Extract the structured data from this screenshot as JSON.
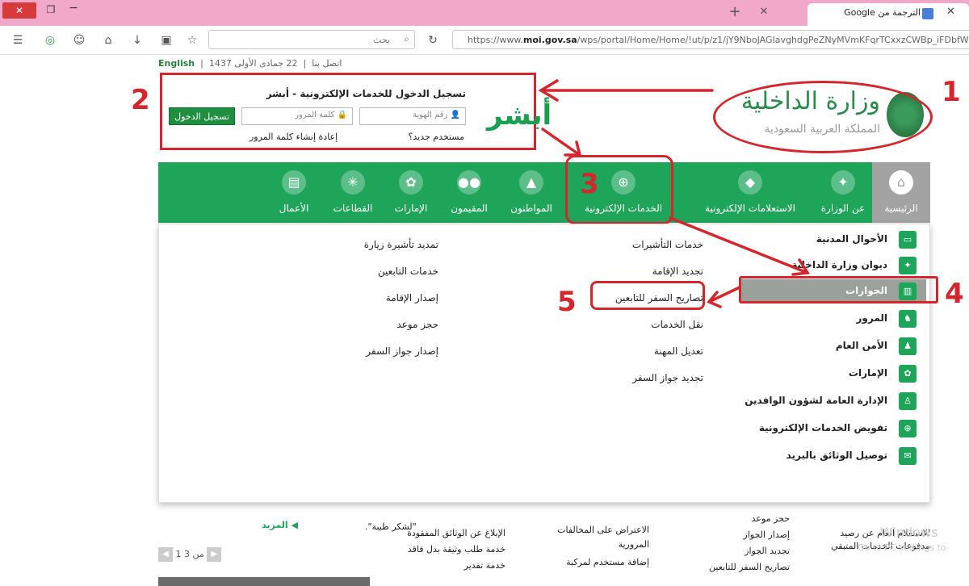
{
  "browser": {
    "tab_title": "الترجمة من Google",
    "search_placeholder": "بحث",
    "url_prefix": "https://www.",
    "url_domain": "moi.gov.sa",
    "url_rest": "/wps/portal/Home/Home/!ut/p/z1/jY9NboJAGIavghdgPeZNyMVmKFqrTCxxzCWBp_iFDbfWv",
    "window_close": "✕",
    "tab_add": "+",
    "tab_close": "✕"
  },
  "topline": {
    "english": "English",
    "contact": "اتصل بنا",
    "date": "22 جمادى الأولى 1437"
  },
  "absher": {
    "title": "تسجيل الدخول للخدمات الإلكترونية - أبشر",
    "id_placeholder": "رقم الهوية",
    "password_placeholder": "كلمة المرور",
    "login_button": "تسجيل الدخول",
    "new_user": "مستخدم جديد؟",
    "reset_password": "إعادة إنشاء كلمة المرور",
    "logo_text": "أبشر"
  },
  "moi": {
    "name": "وزارة الداخلية",
    "subtitle": "المملكة العربية السعودية"
  },
  "annotations": {
    "n1": "1",
    "n2": "2",
    "n3": "3",
    "n4": "4",
    "n5": "5"
  },
  "nav": {
    "home": "الرئيسية",
    "about": "عن الوزارة",
    "inquiries": "الاستعلامات الإلكترونية",
    "eservices": "الخدمات الإلكترونية",
    "citizens": "المواطنون",
    "residents": "المقيمون",
    "emirates": "الإمارات",
    "sectors": "القطاعات",
    "business": "الأعمال"
  },
  "sidebar": [
    "الأحوال المدنية",
    "ديوان وزارة الداخلية",
    "الجوازات",
    "المرور",
    "الأمن العام",
    "الإمارات",
    "الإدارة العامة لشؤون الوافدين",
    "تفويض الخدمات الإلكترونية",
    "توصيل الوثائق بالبريد"
  ],
  "links_col1": [
    "خدمات التأشيرات",
    "تجديد الإقامة",
    "تصاريح السفر للتابعين",
    "نقل الخدمات",
    "تعديل المهنة",
    "تجديد جواز السفر"
  ],
  "links_col2": [
    "تمديد تأشيرة زيارة",
    "خدمات التابعين",
    "إصدار الإقامة",
    "حجز موعد",
    "إصدار جواز السفر"
  ],
  "bottom": {
    "more": "المزيد",
    "thanks": "\"لشكر طيبة\".",
    "pager": "1 من 3",
    "c1": [
      "الإبلاغ عن الوثائق المفقودة",
      "خدمة طلب وثيقة بدل فاقد",
      "خدمة تقدير"
    ],
    "c2": [
      "الاعتراض على المخالفات",
      "المرورية",
      "إضافة مستخدم لمركبة"
    ],
    "c3": [
      "حجز موعد",
      "إصدار الجواز",
      "تجديد الجواز",
      "تصاريح السفر للتابعين"
    ],
    "c4": [
      "الاستعلام العام عن رصيد",
      "مدفوعات الخدمات المتبقي"
    ],
    "watermark": "Windows",
    "watermark2": "Go to PC settings to"
  }
}
